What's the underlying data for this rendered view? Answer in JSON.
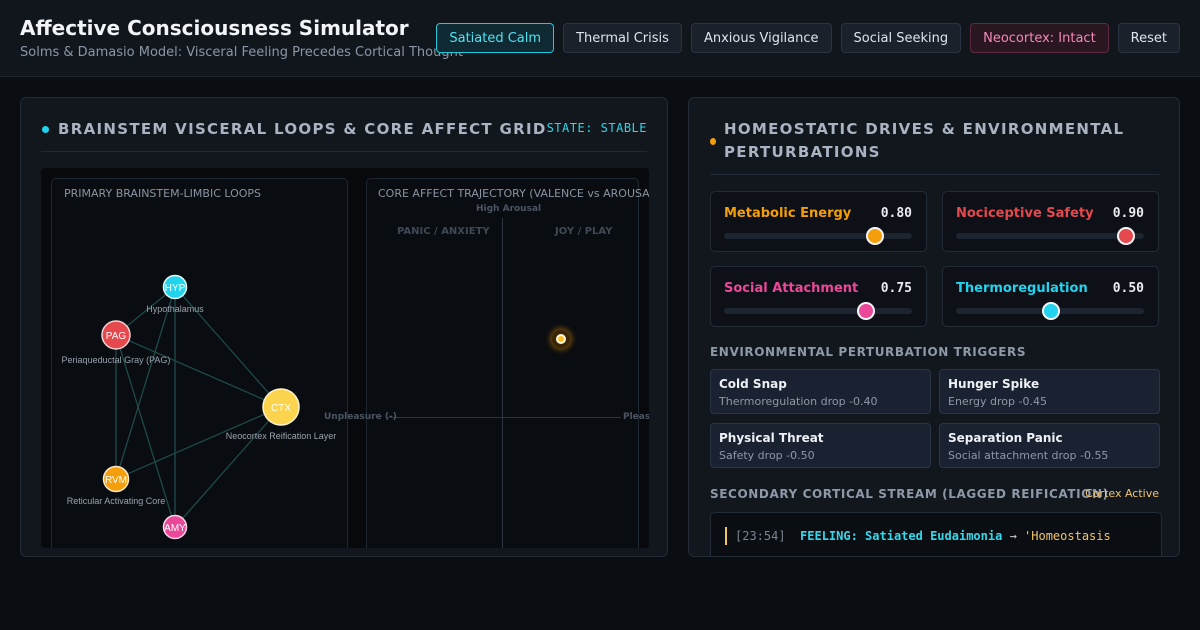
{
  "header": {
    "title": "Affective Consciousness Simulator",
    "subtitle": "Solms & Damasio Model: Visceral Feeling Precedes Cortical Thought",
    "buttons": [
      {
        "label": "Satiated Calm"
      },
      {
        "label": "Thermal Crisis"
      },
      {
        "label": "Anxious Vigilance"
      },
      {
        "label": "Social Seeking"
      },
      {
        "label": "Neocortex: Intact"
      },
      {
        "label": "Reset"
      }
    ]
  },
  "left_panel": {
    "title": "BRAINSTEM VISCERAL LOOPS & CORE AFFECT GRID",
    "state": "STATE: STABLE",
    "loops": {
      "title": "PRIMARY BRAINSTEM-LIMBIC LOOPS",
      "nodes": [
        {
          "abbr": "HYP",
          "label": "Hypothalamus",
          "color": "#22d3ee"
        },
        {
          "abbr": "PAG",
          "label": "Periaqueductal Gray (PAG)",
          "color": "#e5484d"
        },
        {
          "abbr": "CTX",
          "label": "Neocortex Reification Layer",
          "color": "#fcd34d"
        },
        {
          "abbr": "RVM",
          "label": "Reticular Activating Core",
          "color": "#f59e0b"
        },
        {
          "abbr": "AMY",
          "label": "",
          "color": "#ec4899"
        }
      ]
    },
    "grid": {
      "title": "CORE AFFECT TRAJECTORY (VALENCE vs AROUSAL)",
      "high_arousal": "High Arousal",
      "q_panic": "PANIC / ANXIETY",
      "q_joy": "JOY / PLAY",
      "unpleasure": "Unpleasure (-)",
      "pleasure": "Pleasure (+)"
    }
  },
  "right_panel": {
    "title_line1": "HOMEOSTATIC DRIVES & ENVIRONMENTAL",
    "title_line2": "PERTURBATIONS",
    "drives": [
      {
        "name": "Metabolic Energy",
        "value": "0.80",
        "level": 0.8,
        "color": "#f59e0b"
      },
      {
        "name": "Nociceptive Safety",
        "value": "0.90",
        "level": 0.9,
        "color": "#e5484d"
      },
      {
        "name": "Social Attachment",
        "value": "0.75",
        "level": 0.75,
        "color": "#ec4899"
      },
      {
        "name": "Thermoregulation",
        "value": "0.50",
        "level": 0.5,
        "color": "#22d3ee"
      }
    ],
    "triggers_heading": "ENVIRONMENTAL PERTURBATION TRIGGERS",
    "triggers": [
      {
        "name": "Cold Snap",
        "desc": "Thermoregulation drop -0.40"
      },
      {
        "name": "Hunger Spike",
        "desc": "Energy drop -0.45"
      },
      {
        "name": "Physical Threat",
        "desc": "Safety drop -0.50"
      },
      {
        "name": "Separation Panic",
        "desc": "Social attachment drop -0.55"
      }
    ],
    "stream": {
      "heading": "SECONDARY CORTICAL STREAM (LAGGED REIFICATION)",
      "badge": "Cortex Active",
      "log": [
        {
          "time": "[23:54]",
          "feeling": "FEELING: Satiated Eudaimonia",
          "arrow": "→",
          "cortex": "'Homeostasis"
        }
      ]
    }
  }
}
